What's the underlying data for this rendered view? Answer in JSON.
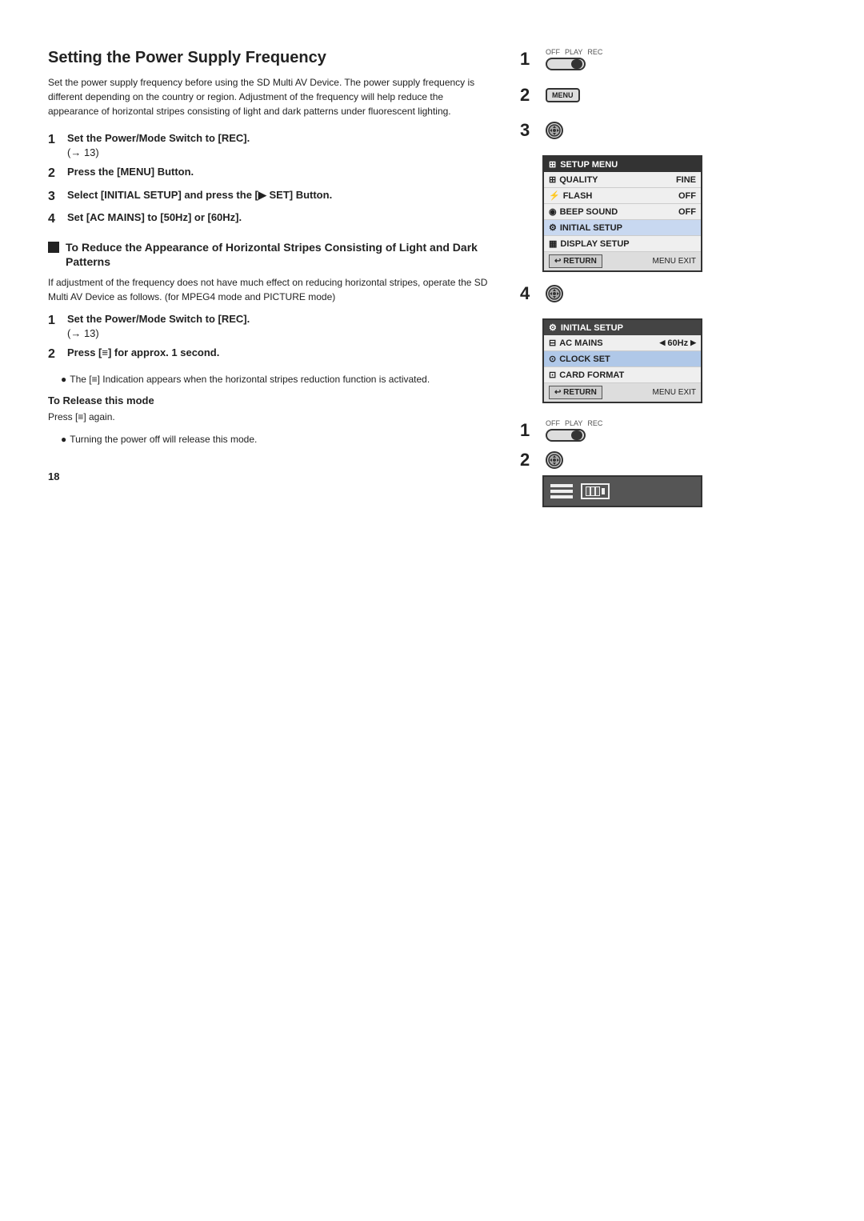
{
  "page": {
    "title": "Setting the Power Supply Frequency",
    "intro": "Set the power supply frequency before using the SD Multi AV Device. The power supply frequency is different depending on the country or region. Adjustment of the frequency will help reduce the appearance of horizontal stripes consisting of light and dark patterns under fluorescent lighting.",
    "steps_main": [
      {
        "num": "1",
        "text": "Set the Power/Mode Switch to [REC]. (→ 13)"
      },
      {
        "num": "2",
        "text": "Press the [MENU] Button."
      },
      {
        "num": "3",
        "text": "Select [INITIAL SETUP] and press the [▶ SET] Button."
      },
      {
        "num": "4",
        "text": "Set [AC MAINS] to [50Hz] or [60Hz]."
      }
    ],
    "section2_title": "To Reduce the Appearance of Horizontal Stripes Consisting of Light and Dark Patterns",
    "section2_body": "If adjustment of the frequency does not have much effect on reducing horizontal stripes, operate the SD Multi AV Device as follows. (for MPEG4 mode and PICTURE mode)",
    "steps_sub": [
      {
        "num": "1",
        "text": "Set the Power/Mode Switch to [REC]. (→ 13)"
      },
      {
        "num": "2",
        "text": "Press [≡] for approx. 1 second."
      }
    ],
    "bullet1": "The [≡] Indication appears when the horizontal stripes reduction function is activated.",
    "release_header": "To Release this mode",
    "release_body": "Press [≡] again.",
    "release_bullet": "Turning the power off will release this mode.",
    "page_number": "18"
  },
  "setup_menu": {
    "title": "SETUP MENU",
    "title_icon": "⊞",
    "rows": [
      {
        "icon": "⊞",
        "label": "QUALITY",
        "value": "FINE",
        "highlighted": false
      },
      {
        "icon": "⚡",
        "label": "FLASH",
        "value": "OFF",
        "highlighted": false
      },
      {
        "icon": "◉",
        "label": "BEEP SOUND",
        "value": "OFF",
        "highlighted": false
      },
      {
        "icon": "⚙",
        "label": "INITIAL SETUP",
        "value": "",
        "highlighted": true
      },
      {
        "icon": "▦",
        "label": "DISPLAY SETUP",
        "value": "",
        "highlighted": false
      }
    ],
    "footer_return": "RETURN",
    "footer_exit": "MENU EXIT"
  },
  "initial_setup_menu": {
    "title": "INITIAL SETUP",
    "title_icon": "⚙",
    "rows": [
      {
        "icon": "⊟",
        "label": "AC MAINS",
        "value": "60Hz",
        "has_arrows": true,
        "highlighted": false
      },
      {
        "icon": "⊙",
        "label": "CLOCK SET",
        "value": "",
        "has_arrows": false,
        "highlighted": true
      },
      {
        "icon": "⊡",
        "label": "CARD FORMAT",
        "value": "",
        "has_arrows": false,
        "highlighted": false
      }
    ],
    "footer_return": "RETURN",
    "footer_exit": "MENU EXIT"
  },
  "mode_switch_labels": {
    "off": "OFF",
    "play": "PLAY",
    "rec": "REC"
  },
  "menu_button_label": "MENU",
  "bottom_display": {
    "lines_label": "≡",
    "battery_label": "battery"
  }
}
